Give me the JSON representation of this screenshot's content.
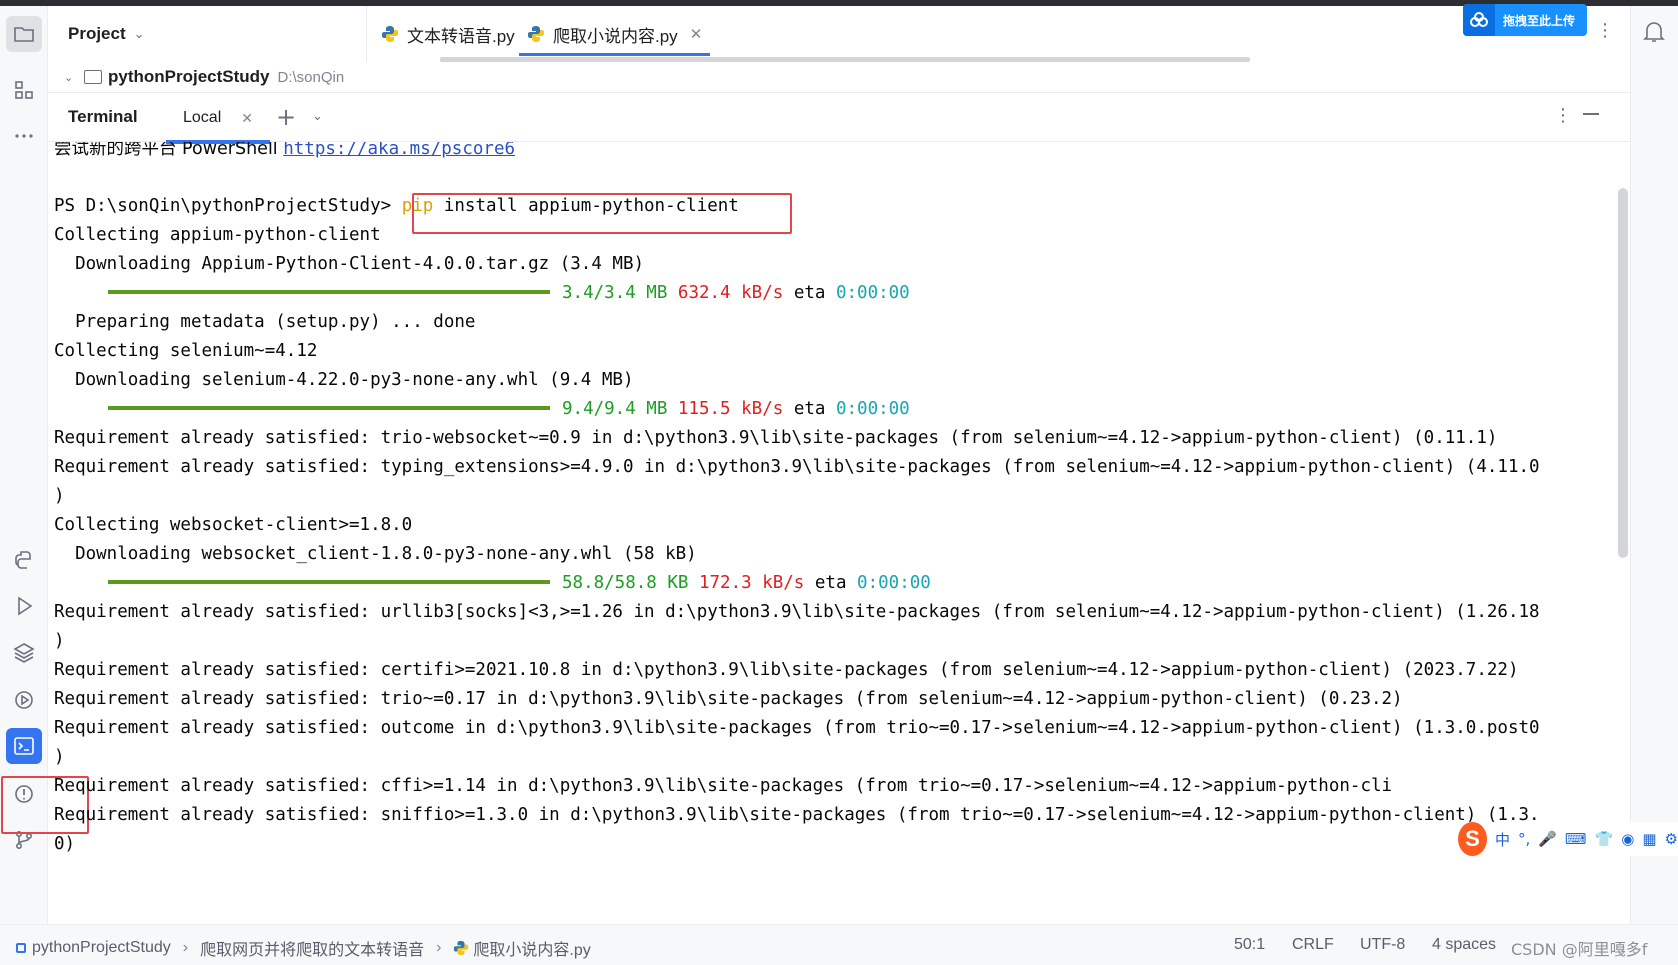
{
  "colors": {
    "accent": "#3574f0",
    "progress_green": "#5a9a1e",
    "highlight_red": "#e0464a"
  },
  "project": {
    "title": "Project",
    "root_name": "pythonProjectStudy",
    "root_path": "D:\\sonQin"
  },
  "tabs": [
    {
      "label": "文本转语音.py",
      "icon": "python-file-icon"
    },
    {
      "label": "爬取小说内容.py",
      "icon": "python-file-icon",
      "active": true
    }
  ],
  "upload_button": {
    "label": "拖拽至此上传"
  },
  "terminal": {
    "title": "Terminal",
    "tab_label": "Local",
    "lines": {
      "l0_text": "尝试新的跨平台 PowerShell ",
      "l0_link": "https://aka.ms/pscore6",
      "prompt": "PS D:\\sonQin\\pythonProjectStudy> ",
      "cmd_pip": "pip",
      "cmd_rest": " install appium-python-client",
      "l2": "Collecting appium-python-client",
      "l3": "  Downloading Appium-Python-Client-4.0.0.tar.gz (3.4 MB)",
      "p1_size": "3.4/3.4 MB",
      "p1_speed": "632.4 kB/s",
      "p1_eta_label": "eta",
      "p1_eta": "0:00:00",
      "l5": "  Preparing metadata (setup.py) ... done",
      "l6": "Collecting selenium~=4.12",
      "l7": "  Downloading selenium-4.22.0-py3-none-any.whl (9.4 MB)",
      "p2_size": "9.4/9.4 MB",
      "p2_speed": "115.5 kB/s",
      "p2_eta_label": "eta",
      "p2_eta": "0:00:00",
      "l9": "Requirement already satisfied: trio-websocket~=0.9 in d:\\python3.9\\lib\\site-packages (from selenium~=4.12->appium-python-client) (0.11.1)",
      "l10": "Requirement already satisfied: typing_extensions>=4.9.0 in d:\\python3.9\\lib\\site-packages (from selenium~=4.12->appium-python-client) (4.11.0",
      "l11": ")",
      "l12": "Collecting websocket-client>=1.8.0",
      "l13": "  Downloading websocket_client-1.8.0-py3-none-any.whl (58 kB)",
      "p3_size": "58.8/58.8 KB",
      "p3_speed": "172.3 kB/s",
      "p3_eta_label": "eta",
      "p3_eta": "0:00:00",
      "l15": "Requirement already satisfied: urllib3[socks]<3,>=1.26 in d:\\python3.9\\lib\\site-packages (from selenium~=4.12->appium-python-client) (1.26.18",
      "l16": ")",
      "l17": "Requirement already satisfied: certifi>=2021.10.8 in d:\\python3.9\\lib\\site-packages (from selenium~=4.12->appium-python-client) (2023.7.22)",
      "l18": "Requirement already satisfied: trio~=0.17 in d:\\python3.9\\lib\\site-packages (from selenium~=4.12->appium-python-client) (0.23.2)",
      "l19": "Requirement already satisfied: outcome in d:\\python3.9\\lib\\site-packages (from trio~=0.17->selenium~=4.12->appium-python-client) (1.3.0.post0",
      "l20": ")",
      "l21": "Requirement already satisfied: cffi>=1.14 in d:\\python3.9\\lib\\site-packages (from trio~=0.17->selenium~=4.12->appium-python-cli",
      "l22": "Requirement already satisfied: sniffio>=1.3.0 in d:\\python3.9\\lib\\site-packages (from trio~=0.17->selenium~=4.12->appium-python-client) (1.3.",
      "l23": "0)"
    }
  },
  "ime_toolbar": {
    "logo": "S",
    "mode": "中",
    "punct": "°,"
  },
  "statusbar": {
    "crumbs": [
      "pythonProjectStudy",
      "爬取网页并将爬取的文本转语音",
      "爬取小说内容.py"
    ],
    "position": "50:1",
    "line_sep": "CRLF",
    "encoding": "UTF-8",
    "indent": "4 spaces",
    "watermark": "CSDN @阿里嘎多f"
  }
}
